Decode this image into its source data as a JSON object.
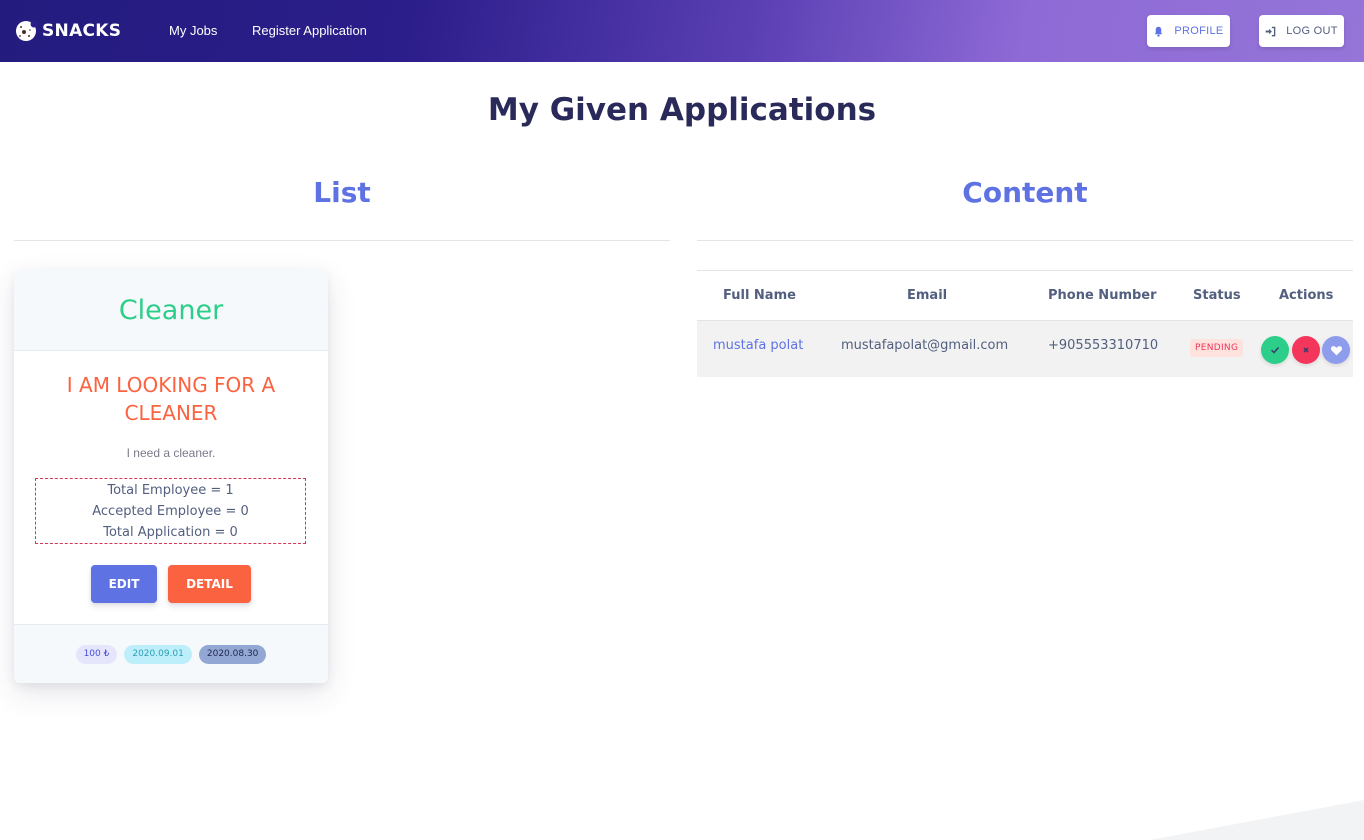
{
  "navbar": {
    "brand": "SNACKS",
    "brand_icon": "cookie-icon",
    "links": [
      {
        "label": "My Jobs"
      },
      {
        "label": "Register Application"
      }
    ],
    "profile_button": {
      "label": "PROFILE",
      "icon": "bell-icon"
    },
    "logout_button": {
      "label": "LOG OUT",
      "icon": "sign-in-icon"
    }
  },
  "page": {
    "title": "My Given Applications",
    "list_title": "List",
    "content_title": "Content"
  },
  "job_card": {
    "category": "Cleaner",
    "title": "I AM LOOKING FOR A CLEANER",
    "description": "I need a cleaner.",
    "stats": [
      "Total Employee = 1",
      "Accepted Employee = 0",
      "Total Application = 0"
    ],
    "edit_label": "EDIT",
    "detail_label": "DETAIL",
    "badges": {
      "price": "100 ₺",
      "date_end": "2020.09.01",
      "date_start": "2020.08.30"
    }
  },
  "applications_table": {
    "columns": [
      "Full Name",
      "Email",
      "Phone Number",
      "Status",
      "Actions"
    ],
    "rows": [
      {
        "full_name": "mustafa polat",
        "email": "mustafapolat@gmail.com",
        "phone": "+905553310710",
        "status": "PENDING",
        "actions": [
          "check-icon",
          "times-icon",
          "heart-icon"
        ]
      }
    ]
  },
  "colors": {
    "primary": "#5e72e4",
    "success": "#2dce89",
    "danger": "#f5365c",
    "warning": "#fb6340",
    "heading": "#2a2a5a"
  }
}
